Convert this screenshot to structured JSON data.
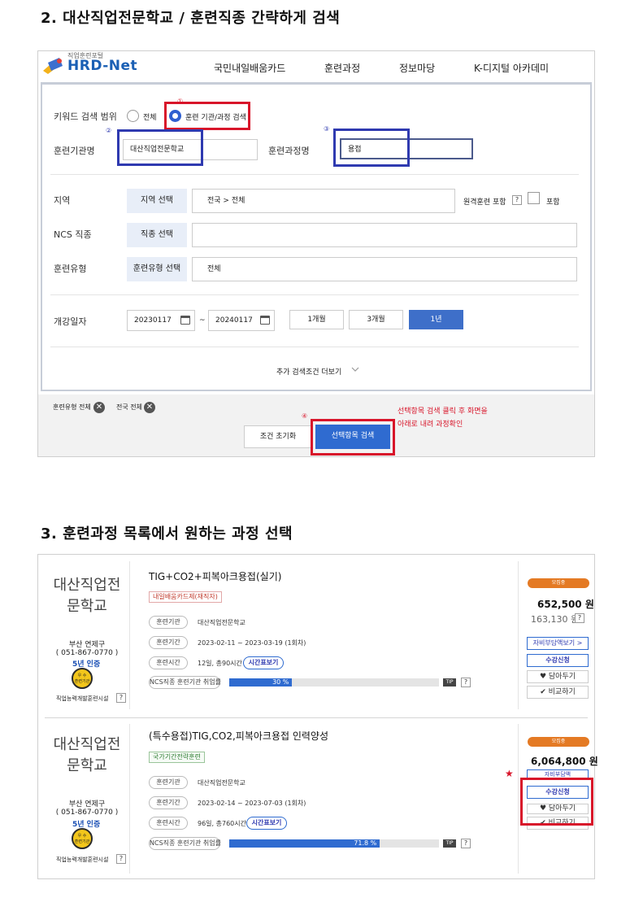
{
  "section2": {
    "title": "2. 대산직업전문학교 / 훈련직종 간략하게 검색",
    "header": {
      "logo_small": "직업훈련포털",
      "logo_main": "HRD-Net",
      "nav": [
        "국민내일배움카드",
        "훈련과정",
        "정보마당",
        "K-디지털 아카데미"
      ]
    },
    "form": {
      "keyword_label": "키워드 검색 범위",
      "radio_all": "전체",
      "radio_inst": "훈련 기관/과정 검색",
      "inst_label": "훈련기관명",
      "inst_value": "대산직업전문학교",
      "course_label": "훈련과정명",
      "course_value": "용접",
      "region_label": "지역",
      "region_btn": "지역 선택",
      "region_value": "전국 > 전체",
      "remote_label": "원격훈련 포함",
      "remote_q": "?",
      "remote_include": "포함",
      "ncs_label": "NCS 직종",
      "ncs_btn": "직종 선택",
      "type_label": "훈련유형",
      "type_btn": "훈련유형 선택",
      "type_value": "전체",
      "date_label": "개강일자",
      "date_from": "20230117",
      "date_to": "20240117",
      "date_sep": "~",
      "period": [
        "1개월",
        "3개월",
        "1년"
      ],
      "more": "추가 검색조건 더보기",
      "chevron_icon": "chevron-down-icon",
      "calendar_icon": "calendar-icon"
    },
    "annotations": {
      "n1": "①",
      "n2": "②",
      "n3": "③",
      "n4": "④"
    },
    "filters": [
      "훈련유형 전체",
      "전국 전체"
    ],
    "filter_close": "✕",
    "reset_btn": "조건 초기화",
    "search_btn": "선택항목 검색",
    "note_line1": "선택항목 검색 클릭 후 화면을",
    "note_line2": "아래로 내려 과정확인"
  },
  "section3": {
    "title": "3. 훈련과정 목록에서 원하는 과정 선택",
    "courses": [
      {
        "inst_line1": "대산직업전",
        "inst_line2": "문학교",
        "addr1": "부산 연제구",
        "addr2": "( 051-867-0770 )",
        "cert": "5년 인증",
        "badge_line1": "우 수",
        "badge_line2": "훈련기관",
        "facility": "직업능력개발훈련시설",
        "title": "TIG+CO2+피복아크용접(실기)",
        "tag": "내일배움카드제(재직자)",
        "rows": [
          {
            "k": "훈련기관",
            "v": "대산직업전문학교"
          },
          {
            "k": "훈련기간",
            "v": "2023-02-11 ~ 2023-03-19 (1회차)"
          },
          {
            "k": "훈련시간",
            "v": "12일, 총90시간"
          }
        ],
        "time_btn": "시간표보기",
        "ncs_label": "NCS직종 훈련기관 취업률",
        "ncs_value": "30 %",
        "ncs_fraction": 0.3,
        "tip": "TIP",
        "status": "모집중",
        "price": "652,500 원",
        "price_sub": "163,130 원",
        "self_pay_btn": "자비부담액보기 >",
        "apply_btn": "수강신청",
        "wish_btn": "담아두기",
        "compare_btn": "비교하기"
      },
      {
        "inst_line1": "대산직업전",
        "inst_line2": "문학교",
        "addr1": "부산 연제구",
        "addr2": "( 051-867-0770 )",
        "cert": "5년 인증",
        "badge_line1": "우 수",
        "badge_line2": "훈련기관",
        "facility": "직업능력개발훈련시설",
        "title": "(특수용접)TIG,CO2,피복아크용접 인력양성",
        "tag": "국가기간전략훈련",
        "rows": [
          {
            "k": "훈련기관",
            "v": "대산직업전문학교"
          },
          {
            "k": "훈련기간",
            "v": "2023-02-14 ~ 2023-07-03 (1회차)"
          },
          {
            "k": "훈련시간",
            "v": "96일, 총760시간"
          }
        ],
        "time_btn": "시간표보기",
        "ncs_label": "NCS직종 훈련기관 취업률",
        "ncs_value": "71.8 %",
        "ncs_fraction": 0.718,
        "tip": "TIP",
        "status": "모집중",
        "price": "6,064,800 원",
        "price_sub": "자비부담액",
        "apply_btn": "수강신청",
        "wish_btn": "담아두기",
        "compare_btn": "비교하기"
      }
    ],
    "q": "?",
    "star": "★"
  }
}
